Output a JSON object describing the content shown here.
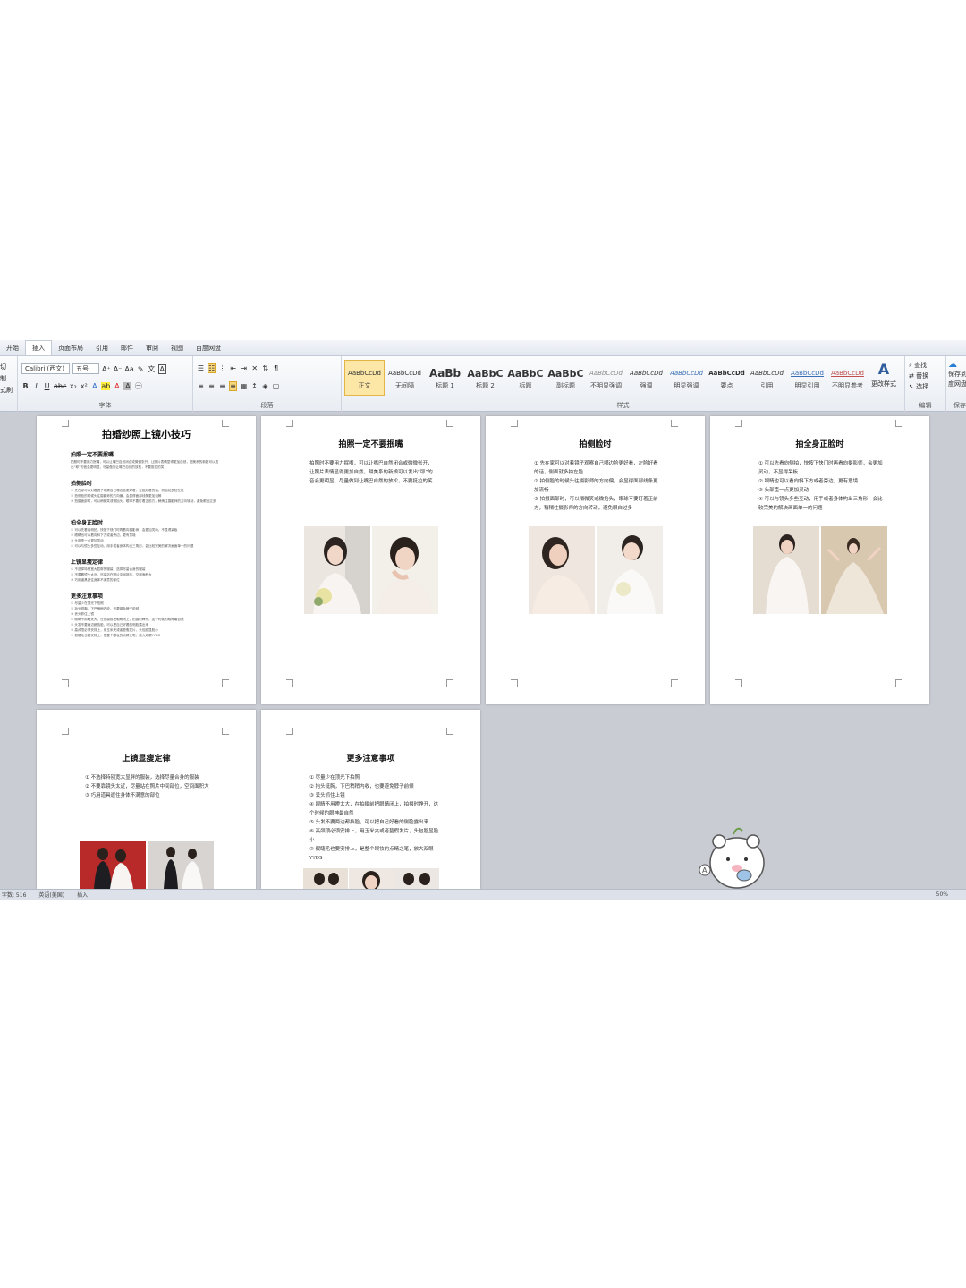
{
  "ribbon": {
    "tabs": [
      "开始",
      "插入",
      "页面布局",
      "引用",
      "邮件",
      "审阅",
      "视图",
      "百度网盘"
    ],
    "clipboard_labels": [
      "切",
      "制",
      "式刷"
    ],
    "font_name": "Calibri (西文)",
    "font_size": "五号",
    "font_group_label": "字体",
    "paragraph_group_label": "段落",
    "styles_group_label": "样式",
    "edit_group_label": "编辑",
    "save_group_label": "保存",
    "styles": [
      {
        "sample": "AaBbCcDd",
        "name": "正文"
      },
      {
        "sample": "AaBbCcDd",
        "name": "无间隔"
      },
      {
        "sample": "AaBb",
        "name": "标题 1"
      },
      {
        "sample": "AaBbC",
        "name": "标题 2"
      },
      {
        "sample": "AaBbC",
        "name": "标题"
      },
      {
        "sample": "AaBbC",
        "name": "副标题"
      },
      {
        "sample": "AaBbCcDd",
        "name": "不明显强调"
      },
      {
        "sample": "AaBbCcDd",
        "name": "强调"
      },
      {
        "sample": "AaBbCcDd",
        "name": "明显强调"
      },
      {
        "sample": "AaBbCcDd",
        "name": "要点"
      },
      {
        "sample": "AaBbCcDd",
        "name": "引用"
      },
      {
        "sample": "AaBbCcDd",
        "name": "明显引用"
      },
      {
        "sample": "AaBbCcDd",
        "name": "不明显参考"
      }
    ],
    "change_styles_label": "更改样式",
    "find_label": "查找",
    "replace_label": "替换",
    "select_label": "选择",
    "save_to_label": "保存到",
    "baidu_label": "度网盘"
  },
  "pages": {
    "p1": {
      "title": "拍婚纱照上镜小技巧",
      "sections": [
        "拍照一定不要抿嘴",
        "拍侧脸时",
        "拍全身正脸时",
        "上镜显瘦定律",
        "更多注意事项"
      ]
    },
    "p2": {
      "title": "拍照一定不要抿嘴",
      "body": "拍照时不要用力抿嘴，可以让嘴巴自然闭合或微微张开，让照片表情显得更加自然，甜美系的新娘可以发出“耶”的音会更明显，尽量做到让嘴巴自然的放松，不要挺拉的笑"
    },
    "p3": {
      "title": "拍侧脸时",
      "items": [
        "① 先在家可以对着镜子观察自己哪边脸更好看，左脸好看的话，侧面就多拍左脸",
        "② 拍侧脸的时候头往摄影师的方向偏，会显得面部线条更加流畅",
        "③ 拍摄面部时，可以稍微笑或微抬头，眼球不要盯着正前方，稍稍往摄影师的方向转动，避免眼白过多"
      ]
    },
    "p4": {
      "title": "拍全身正脸时",
      "items": [
        "① 可以先看向侧拍，快按下快门时再看向摄影师，会更加灵动，不显得呆板",
        "② 眼睛也可以看向斜下方或者旁边，更有意境",
        "③ 头部歪一点更加灵动",
        "④ 可以与镜头多些互动，用手或者身体构出三角形，会比较完美的解决画面单一的问题"
      ]
    },
    "p5": {
      "title": "上镜显瘦定律",
      "items": [
        "① 不选择特别宽大显胖的服装，选择尽量合身的服装",
        "② 不要靠镜头太近，尽量站在照片中间部位，空间面积大",
        "③ 巧用道具遮住身体不满意的部位"
      ]
    },
    "p6": {
      "title": "更多注意事项",
      "items": [
        "① 尽量少在顶光下拍照",
        "② 抬头挺胸，下巴稍稍内收，也要避免脖子前倾",
        "③ 丢头抓住上镜",
        "④ 眼睛不用瞪太大，在拍摄前把眼睛闭上，拍摄时睁开，这个时候的眼神最自然",
        "⑤ 头发不要两边都挡脸，可以把自己好看的侧脸露出来",
        "⑥ 高颅顶必须安排上，用玉米夹或者垫假发片，头包脸显脸小",
        "⑦ 假睫毛也要安排上，是整个眼妆的点睛之笔，放大双眼YYDS"
      ]
    }
  },
  "statusbar": {
    "words": "字数: 516",
    "language": "英语(美国)",
    "mode": "插入",
    "zoom": "50%"
  }
}
